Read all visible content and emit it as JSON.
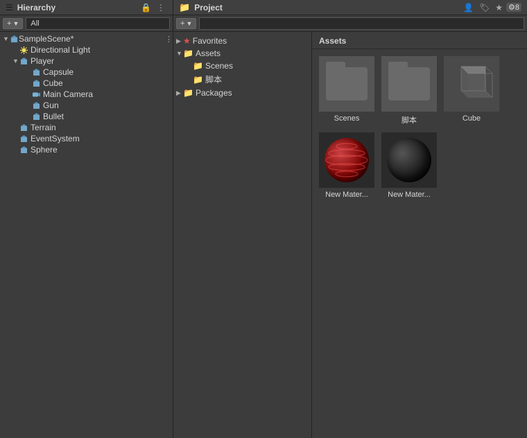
{
  "hierarchy": {
    "title": "Hierarchy",
    "search_placeholder": "All",
    "add_button": "+",
    "scene_name": "SampleScene*",
    "items": [
      {
        "id": "directional-light",
        "label": "Directional Light",
        "type": "light",
        "indent": 1,
        "expanded": false
      },
      {
        "id": "player",
        "label": "Player",
        "type": "go",
        "indent": 1,
        "expanded": true
      },
      {
        "id": "capsule",
        "label": "Capsule",
        "type": "go",
        "indent": 2,
        "expanded": false
      },
      {
        "id": "cube",
        "label": "Cube",
        "type": "cube",
        "indent": 2,
        "expanded": false
      },
      {
        "id": "main-camera",
        "label": "Main Camera",
        "type": "camera",
        "indent": 2,
        "expanded": false
      },
      {
        "id": "gun",
        "label": "Gun",
        "type": "go",
        "indent": 2,
        "expanded": false
      },
      {
        "id": "bullet",
        "label": "Bullet",
        "type": "go",
        "indent": 2,
        "expanded": false
      },
      {
        "id": "terrain",
        "label": "Terrain",
        "type": "terrain",
        "indent": 1,
        "expanded": false
      },
      {
        "id": "eventsystem",
        "label": "EventSystem",
        "type": "go",
        "indent": 1,
        "expanded": false
      },
      {
        "id": "sphere",
        "label": "Sphere",
        "type": "go",
        "indent": 1,
        "expanded": false
      }
    ]
  },
  "project": {
    "title": "Project",
    "search_placeholder": "",
    "add_button": "+",
    "tree": [
      {
        "id": "favorites",
        "label": "Favorites",
        "indent": 0,
        "expanded": false,
        "star": true
      },
      {
        "id": "assets",
        "label": "Assets",
        "indent": 0,
        "expanded": true
      },
      {
        "id": "scenes",
        "label": "Scenes",
        "indent": 1,
        "expanded": false
      },
      {
        "id": "scripts",
        "label": "脚本",
        "indent": 1,
        "expanded": false
      },
      {
        "id": "packages",
        "label": "Packages",
        "indent": 0,
        "expanded": false
      }
    ],
    "assets_header": "Assets",
    "assets": [
      {
        "id": "scenes-folder",
        "label": "Scenes",
        "type": "folder"
      },
      {
        "id": "scripts-folder",
        "label": "脚本",
        "type": "folder"
      },
      {
        "id": "cube-asset",
        "label": "Cube",
        "type": "cube3d"
      },
      {
        "id": "mat-red",
        "label": "New Mater...",
        "type": "sphere-red"
      },
      {
        "id": "mat-black",
        "label": "New Mater...",
        "type": "sphere-black"
      }
    ]
  },
  "toolbar": {
    "lock_icon": "🔒",
    "menu_icon": "⋮",
    "star_icon": "★",
    "search_icon": "🔍",
    "profile_icon": "👤",
    "layers_icon": "☰",
    "number_badge": "8"
  }
}
